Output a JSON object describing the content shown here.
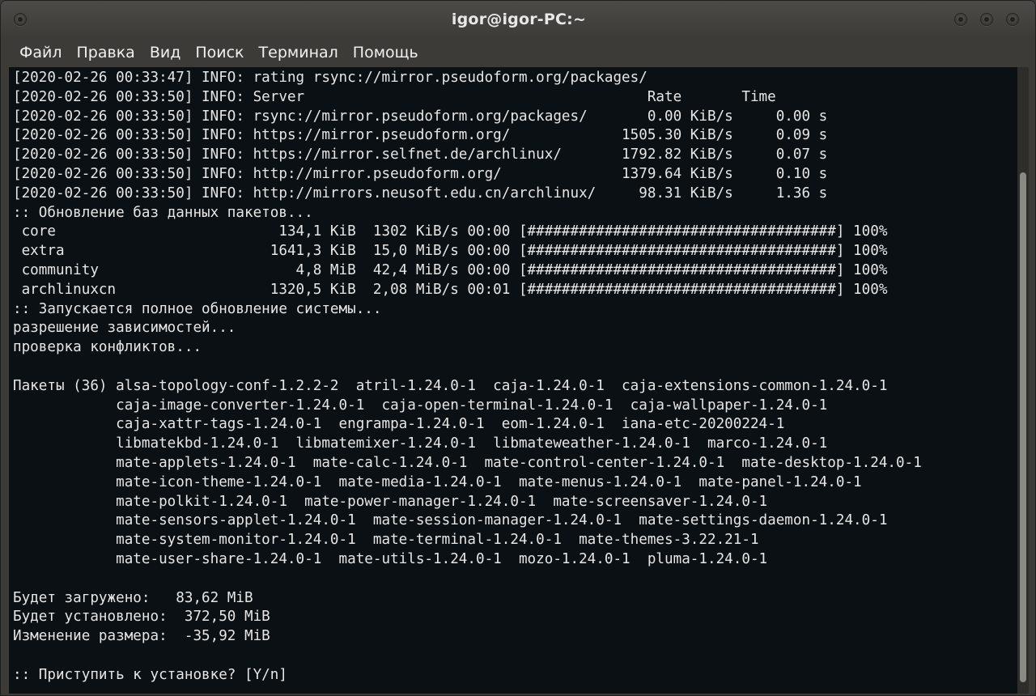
{
  "window": {
    "title": "igor@igor-PC:~"
  },
  "menu": {
    "items": [
      "Файл",
      "Правка",
      "Вид",
      "Поиск",
      "Терминал",
      "Помощь"
    ]
  },
  "terminal": {
    "lines": [
      "[2020-02-26 00:33:47] INFO: rating rsync://mirror.pseudoform.org/packages/",
      "[2020-02-26 00:33:50] INFO: Server                                        Rate       Time",
      "[2020-02-26 00:33:50] INFO: rsync://mirror.pseudoform.org/packages/       0.00 KiB/s     0.00 s",
      "[2020-02-26 00:33:50] INFO: https://mirror.pseudoform.org/             1505.30 KiB/s     0.09 s",
      "[2020-02-26 00:33:50] INFO: https://mirror.selfnet.de/archlinux/       1792.82 KiB/s     0.07 s",
      "[2020-02-26 00:33:50] INFO: http://mirror.pseudoform.org/              1379.64 KiB/s     0.10 s",
      "[2020-02-26 00:33:50] INFO: http://mirrors.neusoft.edu.cn/archlinux/     98.31 KiB/s     1.36 s",
      ":: Обновление баз данных пакетов...",
      " core                          134,1 KiB  1302 KiB/s 00:00 [####################################] 100%",
      " extra                        1641,3 KiB  15,0 MiB/s 00:00 [####################################] 100%",
      " community                       4,8 MiB  42,4 MiB/s 00:00 [####################################] 100%",
      " archlinuxcn                  1320,5 KiB  2,08 MiB/s 00:01 [####################################] 100%",
      ":: Запускается полное обновление системы...",
      "разрешение зависимостей...",
      "проверка конфликтов...",
      "",
      "Пакеты (36) alsa-topology-conf-1.2.2-2  atril-1.24.0-1  caja-1.24.0-1  caja-extensions-common-1.24.0-1",
      "            caja-image-converter-1.24.0-1  caja-open-terminal-1.24.0-1  caja-wallpaper-1.24.0-1",
      "            caja-xattr-tags-1.24.0-1  engrampa-1.24.0-1  eom-1.24.0-1  iana-etc-20200224-1",
      "            libmatekbd-1.24.0-1  libmatemixer-1.24.0-1  libmateweather-1.24.0-1  marco-1.24.0-1",
      "            mate-applets-1.24.0-1  mate-calc-1.24.0-1  mate-control-center-1.24.0-1  mate-desktop-1.24.0-1",
      "            mate-icon-theme-1.24.0-1  mate-media-1.24.0-1  mate-menus-1.24.0-1  mate-panel-1.24.0-1",
      "            mate-polkit-1.24.0-1  mate-power-manager-1.24.0-1  mate-screensaver-1.24.0-1",
      "            mate-sensors-applet-1.24.0-1  mate-session-manager-1.24.0-1  mate-settings-daemon-1.24.0-1",
      "            mate-system-monitor-1.24.0-1  mate-terminal-1.24.0-1  mate-themes-3.22.21-1",
      "            mate-user-share-1.24.0-1  mate-utils-1.24.0-1  mozo-1.24.0-1  pluma-1.24.0-1",
      "",
      "Будет загружено:   83,62 MiB",
      "Будет установлено:  372,50 MiB",
      "Изменение размера:  -35,92 MiB",
      "",
      ":: Приступить к установке? [Y/n]"
    ]
  }
}
